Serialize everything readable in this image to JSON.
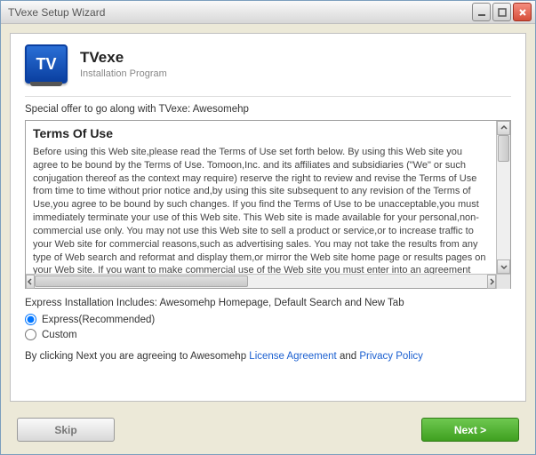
{
  "window": {
    "title": "TVexe Setup Wizard"
  },
  "header": {
    "logo_text": "TV",
    "product_name": "TVexe",
    "subtitle": "Installation Program"
  },
  "offer_line": "Special offer to go along with TVexe: Awesomehp",
  "terms": {
    "title": "Terms Of Use",
    "body": "Before using this Web site,please read the Terms of Use set forth below. By using this Web site you agree to be bound by the Terms of Use. Tomoon,Inc. and its affiliates and subsidiaries (\"We\" or such conjugation thereof as the context may require) reserve the right to review and revise the Terms of Use from time to time without prior notice and,by using this site subsequent to any revision of the Terms of Use,you agree to be bound by such changes. If you find the Terms of Use to be unacceptable,you must immediately terminate your use of this Web site. This Web site is made available for your personal,non-commercial use only. You may not use this Web site to sell a product or service,or to increase traffic to your Web site for commercial reasons,such as advertising sales. You may not take the results from any type of Web search and reformat and display them,or mirror the Web site home page or results pages on your Web site. If you want to make commercial use of the Web site you must enter into an agreement with"
  },
  "includes_line": "Express Installation Includes: Awesomehp Homepage, Default Search and New Tab",
  "radios": {
    "express": "Express(Recommended)",
    "custom": "Custom",
    "selected": "express"
  },
  "agree": {
    "prefix": "By clicking Next you are agreeing to Awesomehp ",
    "link1": "License Agreement",
    "mid": " and ",
    "link2": "Privacy Policy"
  },
  "buttons": {
    "skip": "Skip",
    "next": "Next >"
  }
}
